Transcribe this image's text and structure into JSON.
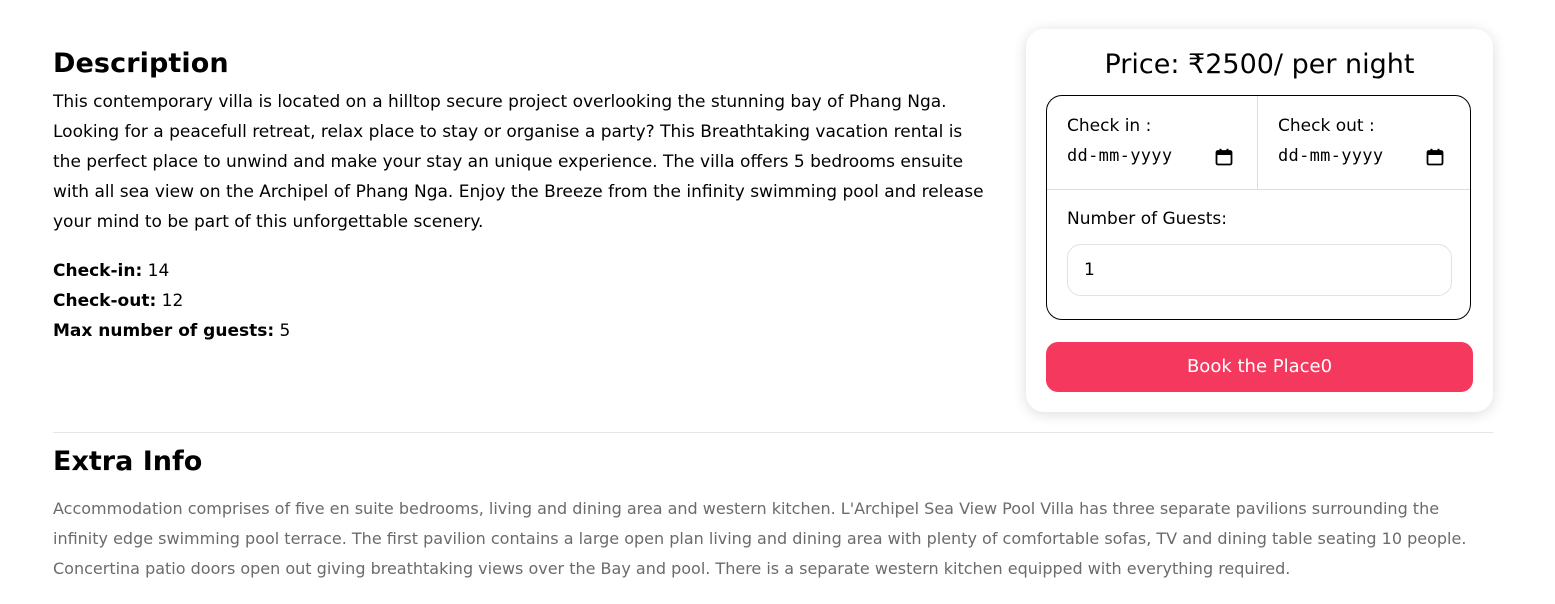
{
  "description": {
    "title": "Description",
    "text": "This contemporary villa is located on a hilltop secure project overlooking the stunning bay of Phang Nga. Looking for a peacefull retreat, relax place to stay or organise a party? This Breathtaking vacation rental is the perfect place to unwind and make your stay an unique experience. The villa offers 5 bedrooms ensuite with all sea view on the Archipel of Phang Nga. Enjoy the Breeze from the infinity swimming pool and release your mind to be part of this unforgettable scenery."
  },
  "facts": {
    "checkin_label": "Check-in:",
    "checkin_value": " 14",
    "checkout_label": "Check-out:",
    "checkout_value": " 12",
    "max_guests_label": "Max number of guests:",
    "max_guests_value": " 5"
  },
  "booking": {
    "price": "Price: ₹2500/ per night",
    "checkin_label": "Check in :",
    "checkin_placeholder": "dd-mm-yyyy",
    "checkout_label": "Check out :",
    "checkout_placeholder": "dd-mm-yyyy",
    "calendar_icon": "calendar-icon",
    "guests_label": "Number of Guests:",
    "guests_value": "1",
    "button_label": "Book the Place0",
    "accent_color": "#f5385d"
  },
  "extra": {
    "title": "Extra Info",
    "text": "Accommodation comprises of five en suite bedrooms, living and dining area and western kitchen. L'Archipel Sea View Pool Villa has three separate pavilions surrounding the infinity edge swimming pool terrace. The first pavilion contains a large open plan living and dining area with plenty of comfortable sofas, TV and dining table seating 10 people. Concertina patio doors open out giving breathtaking views over the Bay and pool. There is a separate western kitchen equipped with everything required."
  }
}
